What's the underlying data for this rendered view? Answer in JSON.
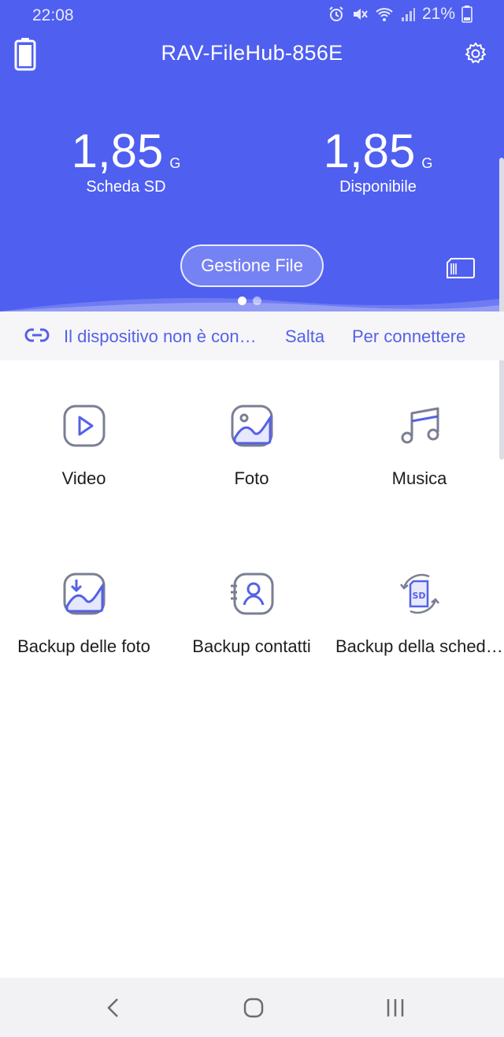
{
  "status_bar": {
    "time": "22:08",
    "battery_percent": "21%",
    "icons": [
      "alarm-icon",
      "mute-icon",
      "wifi-icon",
      "signal-icon",
      "battery-icon"
    ]
  },
  "header": {
    "device_name": "RAV-FileHub-856E",
    "icons": {
      "left": "device-battery-icon",
      "right": "gear-icon"
    },
    "stats": [
      {
        "value": "1,85",
        "unit": "G",
        "label": "Scheda SD"
      },
      {
        "value": "1,85",
        "unit": "G",
        "label": "Disponibile"
      }
    ],
    "manage_button": "Gestione File",
    "page_indicator": {
      "pages": 2,
      "active": 1
    }
  },
  "connection_bar": {
    "message": "Il dispositivo non è connesso",
    "skip_label": "Salta",
    "connect_label": "Per connettere"
  },
  "grid": [
    {
      "label": "Video",
      "icon": "video-play-icon"
    },
    {
      "label": "Foto",
      "icon": "photo-icon"
    },
    {
      "label": "Musica",
      "icon": "music-icon"
    },
    {
      "label": "Backup delle foto",
      "icon": "photo-backup-icon"
    },
    {
      "label": "Backup contatti",
      "icon": "contacts-backup-icon"
    },
    {
      "label": "Backup della scheda SD",
      "icon": "sd-backup-icon"
    }
  ],
  "colors": {
    "header_bg": "#4f5ff0",
    "accent": "#5561e6",
    "icon_stroke": "#7a7f93",
    "icon_accent": "#5561e6"
  }
}
